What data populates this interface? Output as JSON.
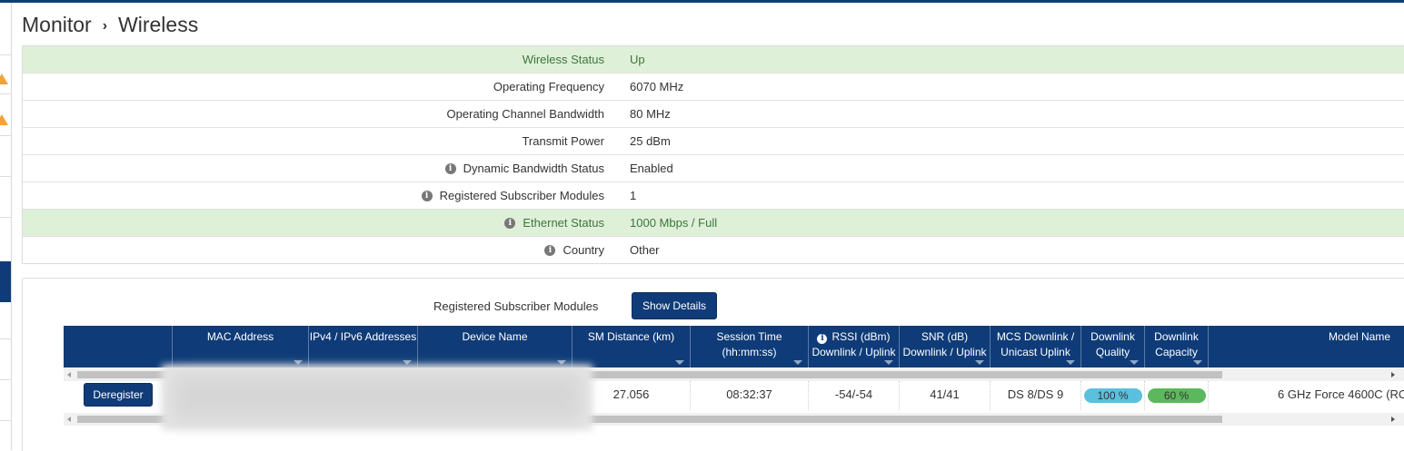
{
  "breadcrumb": {
    "section": "Monitor",
    "page": "Wireless"
  },
  "status": [
    {
      "label": "Wireless Status",
      "value": "Up",
      "info": false,
      "highlight": true
    },
    {
      "label": "Operating Frequency",
      "value": "6070 MHz",
      "info": false,
      "highlight": false
    },
    {
      "label": "Operating Channel Bandwidth",
      "value": "80 MHz",
      "info": false,
      "highlight": false
    },
    {
      "label": "Transmit Power",
      "value": "25 dBm",
      "info": false,
      "highlight": false
    },
    {
      "label": "Dynamic Bandwidth Status",
      "value": "Enabled",
      "info": true,
      "highlight": false
    },
    {
      "label": "Registered Subscriber Modules",
      "value": "1",
      "info": true,
      "highlight": false
    },
    {
      "label": "Ethernet Status",
      "value": "1000 Mbps / Full",
      "info": true,
      "highlight": true
    },
    {
      "label": "Country",
      "value": "Other",
      "info": true,
      "highlight": false
    }
  ],
  "modules": {
    "label": "Registered Subscriber Modules",
    "show_details_label": "Show Details",
    "columns": [
      {
        "line1": "",
        "line2": ""
      },
      {
        "line1": "MAC Address",
        "line2": ""
      },
      {
        "line1": "IPv4 / IPv6 Addresses",
        "line2": ""
      },
      {
        "line1": "Device Name",
        "line2": ""
      },
      {
        "line1": "SM Distance (km)",
        "line2": ""
      },
      {
        "line1": "Session Time",
        "line2": "(hh:mm:ss)"
      },
      {
        "line1": "RSSI (dBm)",
        "line2": "Downlink / Uplink"
      },
      {
        "line1": "SNR (dB)",
        "line2": "Downlink / Uplink"
      },
      {
        "line1": "MCS Downlink /",
        "line2": "Unicast Uplink"
      },
      {
        "line1": "Downlink",
        "line2": "Quality"
      },
      {
        "line1": "Downlink",
        "line2": "Capacity"
      },
      {
        "line1": "Model Name",
        "line2": ""
      }
    ],
    "rows": [
      {
        "deregister_label": "Deregister",
        "mac": "",
        "ip": "",
        "device_name": "",
        "distance": "27.056",
        "session_time": "08:32:37",
        "rssi": "-54/-54",
        "snr": "41/41",
        "mcs": "DS 8/DS 9",
        "quality": "100 %",
        "capacity": "60 %",
        "model": "6 GHz Force 4600C (RC"
      }
    ]
  },
  "colors": {
    "primary": "#0f3c78",
    "status_ok_bg": "#dff0d8",
    "status_ok_text": "#3c763d",
    "quality_pill": "#5bc0de",
    "capacity_pill": "#5cb85c",
    "sidebar_warning": "#f0a23c"
  },
  "icons": [
    "chevron-right-icon",
    "info-icon",
    "warning-icon",
    "sort-caret-icon",
    "scroll-left-icon",
    "scroll-right-icon"
  ]
}
